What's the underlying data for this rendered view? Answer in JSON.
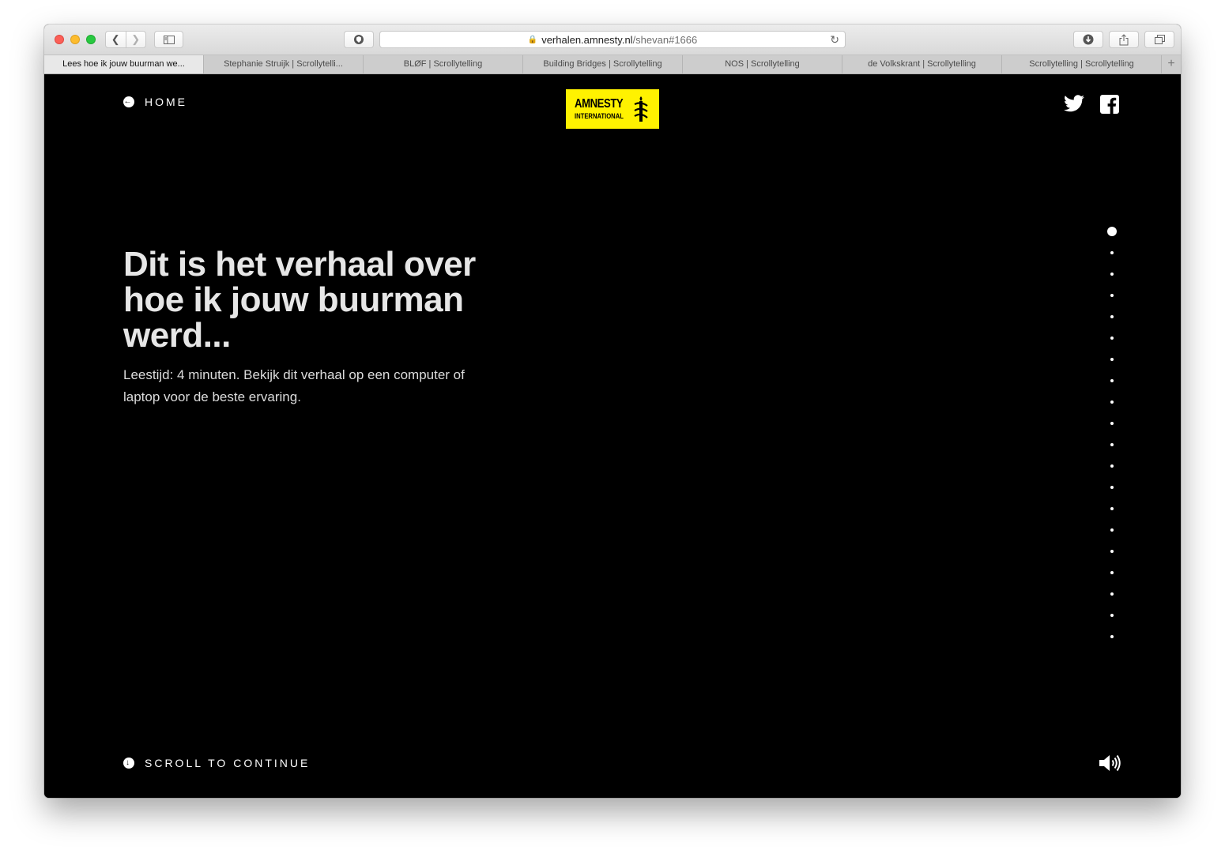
{
  "browser": {
    "url_domain": "verhalen.amnesty.nl",
    "url_path": "/shevan#1666",
    "tabs": [
      {
        "label": "Lees hoe ik jouw buurman we..."
      },
      {
        "label": "Stephanie Struijk | Scrollytelli..."
      },
      {
        "label": "BLØF | Scrollytelling"
      },
      {
        "label": "Building Bridges | Scrollytelling"
      },
      {
        "label": "NOS | Scrollytelling"
      },
      {
        "label": "de Volkskrant | Scrollytelling"
      },
      {
        "label": "Scrollytelling | Scrollytelling"
      }
    ],
    "new_tab_label": "+"
  },
  "nav": {
    "home_label": "HOME",
    "logo_line1": "AMNESTY",
    "logo_line2": "INTERNATIONAL"
  },
  "hero": {
    "headline": "Dit is het verhaal over hoe ik jouw buurman werd...",
    "subtitle": "Leestijd: 4 minuten. Bekijk dit verhaal op een computer of laptop voor de beste ervaring."
  },
  "progress": {
    "total_sections": 20,
    "current_section": 1
  },
  "footer": {
    "scroll_label": "SCROLL TO CONTINUE"
  },
  "colors": {
    "brand_yellow": "#fff200",
    "page_background": "#000000"
  },
  "icons": [
    "back-icon",
    "forward-icon",
    "sidebar-icon",
    "privacy-icon",
    "lock-icon",
    "reload-icon",
    "download-icon",
    "share-icon",
    "tabs-icon",
    "arrow-left-circle-icon",
    "candle-icon",
    "twitter-icon",
    "facebook-icon",
    "arrow-down-circle-icon",
    "speaker-icon"
  ]
}
